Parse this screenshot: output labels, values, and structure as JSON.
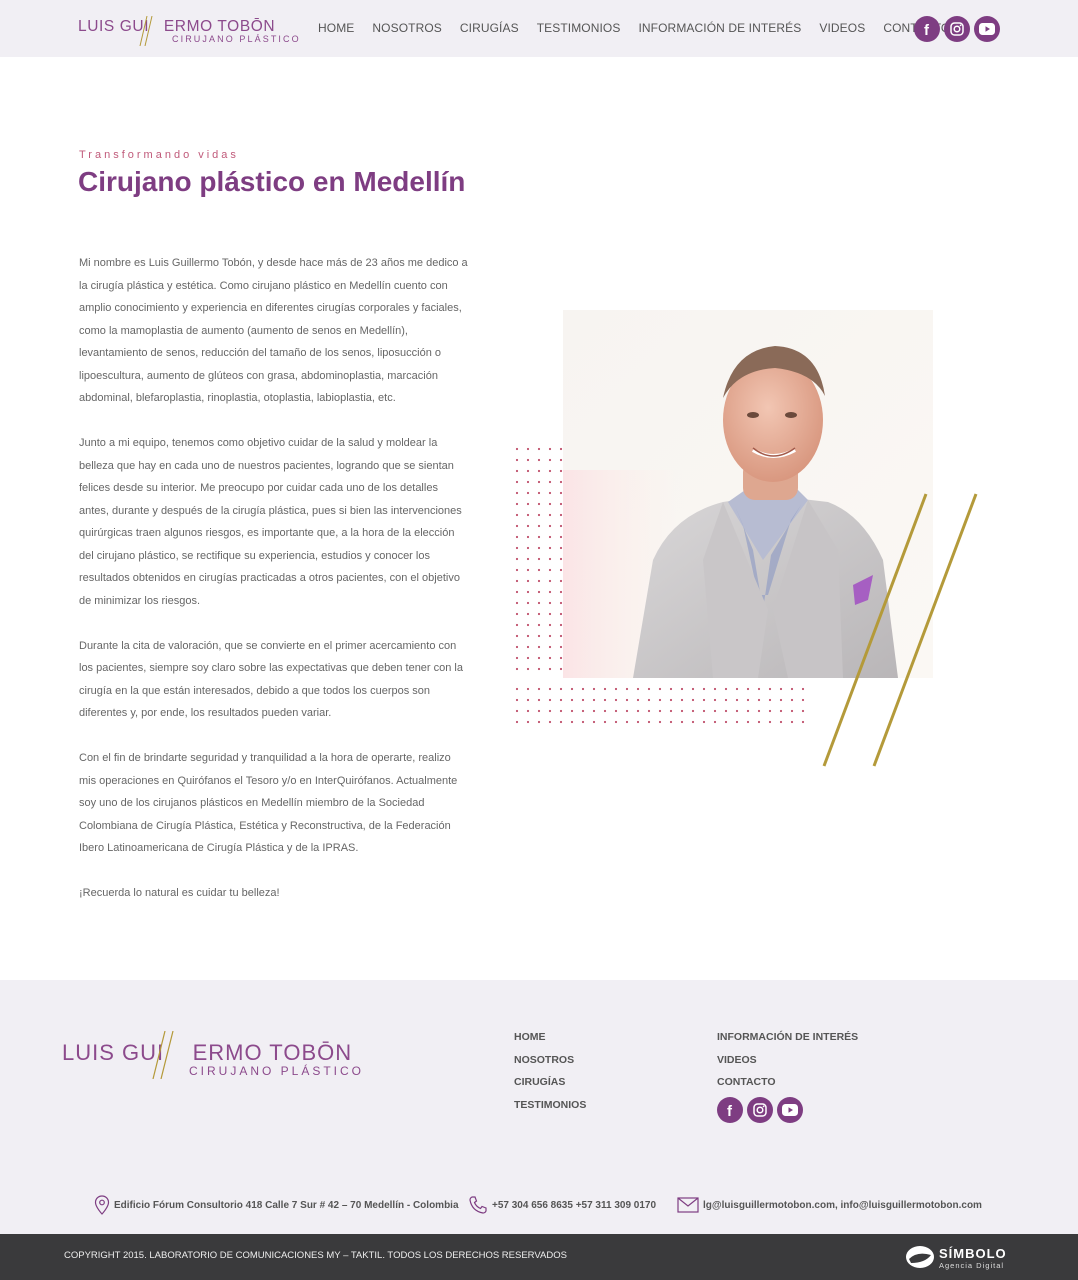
{
  "brand": {
    "name_part1": "LUIS GUI",
    "name_part2": "ERMO TOBŌN",
    "subtitle": "CIRUJANO PLÁSTICO",
    "accent_color": "#7e3d82",
    "gold_color": "#b49a3a"
  },
  "nav": {
    "items": [
      "HOME",
      "NOSOTROS",
      "CIRUGÍAS",
      "TESTIMONIOS",
      "INFORMACIÓN DE INTERÉS",
      "VIDEOS",
      "CONTACTO"
    ]
  },
  "social": [
    "facebook-icon",
    "instagram-icon",
    "youtube-icon"
  ],
  "hero": {
    "eyebrow": "Transformando vidas",
    "title_plain": "Cirujano plástico en ",
    "title_bold": "Medellín"
  },
  "body": {
    "p1": "Mi nombre es Luis Guillermo Tobón, y desde hace más de 23 años me dedico a la cirugía plástica y estética. Como cirujano plástico en Medellín cuento con amplio conocimiento y experiencia en diferentes cirugías corporales y faciales, como la mamoplastia de aumento (aumento de senos en Medellín), levantamiento de senos, reducción del tamaño de los senos, liposucción o lipoescultura, aumento de glúteos con grasa, abdominoplastia, marcación abdominal, blefaroplastia, rinoplastia, otoplastia, labioplastia, etc.",
    "p2": "Junto a mi equipo, tenemos como objetivo cuidar de la salud y moldear la belleza que hay en cada uno de nuestros pacientes, logrando que se sientan felices desde su interior. Me preocupo por cuidar cada uno de los detalles antes, durante y después de la cirugía plástica, pues si bien las intervenciones quirúrgicas traen algunos riesgos, es importante que, a la hora de la elección del cirujano plástico, se rectifique su experiencia, estudios y conocer los resultados obtenidos en cirugías practicadas a otros pacientes, con el objetivo de minimizar los riesgos.",
    "p3": "Durante la cita de valoración, que se convierte en el primer acercamiento con los pacientes, siempre soy claro sobre las expectativas que deben tener con la cirugía en la que están interesados, debido a que todos los cuerpos son diferentes y, por ende, los resultados pueden variar.",
    "p4": "Con el fin de brindarte seguridad y tranquilidad a la hora de operarte, realizo mis operaciones en Quirófanos el Tesoro y/o en InterQuirófanos. Actualmente soy uno de los cirujanos plásticos en Medellín miembro de la Sociedad Colombiana de Cirugía Plástica, Estética y Reconstructiva, de la Federación Ibero Latinoamericana de Cirugía Plástica y de la IPRAS.",
    "p5": "¡Recuerda lo natural es cuidar tu belleza!"
  },
  "footer": {
    "col1": [
      "HOME",
      "NOSOTROS",
      "CIRUGÍAS",
      "TESTIMONIOS"
    ],
    "col2": [
      "INFORMACIÓN DE INTERÉS",
      "VIDEOS",
      "CONTACTO"
    ],
    "address": "Edificio Fórum Consultorio 418 Calle 7 Sur # 42 – 70 Medellín - Colombia",
    "phone": "+57 304 656 8635 +57 311 309 0170",
    "email": "lg@luisguillermotobon.com, info@luisguillermotobon.com",
    "copyright": "COPYRIGHT 2015. LABORATORIO DE COMUNICACIONES MY – TAKTIL. TODOS LOS DERECHOS RESERVADOS",
    "agency_name": "SÍMBOLO",
    "agency_sub": "Agencia Digital"
  }
}
